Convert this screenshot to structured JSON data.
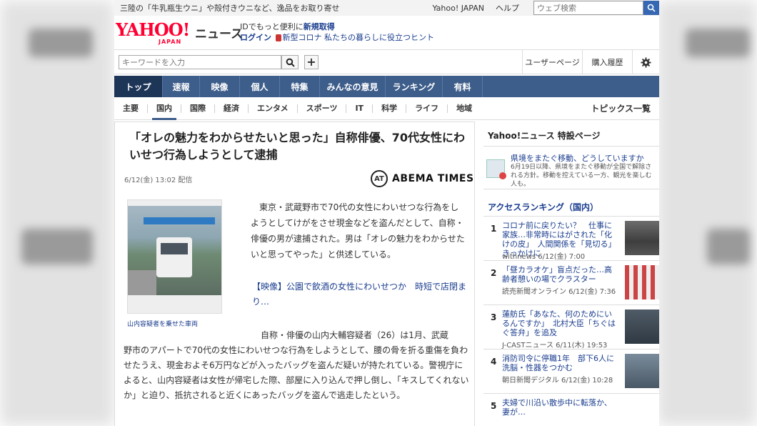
{
  "top_strip": {
    "promo": "三陸の「牛乳瓶生ウニ」や殻付きウニなど、逸品をお取り寄せ",
    "links": [
      "Yahoo! JAPAN",
      "ヘルプ"
    ],
    "web_search_placeholder": "ウェブ検索"
  },
  "header": {
    "logo": "YAHOO!",
    "logo_sub": "JAPAN",
    "news": "ニュース",
    "line1_text": "IDでもっと便利に",
    "line1_link": "新規取得",
    "login": "ログイン",
    "covid": "新型コロナ 私たちの暮らしに役立つヒント"
  },
  "search": {
    "placeholder": "キーワードを入力",
    "user_page": "ユーザーページ",
    "purchase": "購入履歴"
  },
  "main_nav": [
    "トップ",
    "速報",
    "映像",
    "個人",
    "特集",
    "みんなの意見",
    "ランキング",
    "有料"
  ],
  "sub_nav": [
    "主要",
    "国内",
    "国際",
    "経済",
    "エンタメ",
    "スポーツ",
    "IT",
    "科学",
    "ライフ",
    "地域"
  ],
  "sub_nav_right": "トピックス一覧",
  "article": {
    "headline": "「オレの魅力をわからせたいと思った」自称俳優、70代女性にわいせつ行為しようとして逮捕",
    "date": "6/12(金) 13:02 配信",
    "source": "ABEMA TIMES",
    "source_mark": "AT",
    "caption": "山内容疑者を乗せた車両",
    "p1": "東京・武蔵野市で70代の女性にわいせつな行為をしようとしてけがをさせ現金などを盗んだとして、自称・俳優の男が逮捕された。男は「オレの魅力をわからせたいと思ってやった」と供述している。",
    "related": "【映像】公園で飲酒の女性にわいせつか　時短で店閉まり…",
    "p2_first": "自称・俳優の山内大輔容疑者（26）は1月、武蔵",
    "p2_rest": "野市のアパートで70代の女性にわいせつな行為をしようとして、腰の骨を折る重傷を負わせたうえ、現金およそ6万円などが入ったバッグを盗んだ疑いが持たれている。警視庁によると、山内容疑者は女性が帰宅した際、部屋に入り込んで押し倒し、「キスしてくれないか」と迫り、抵抗されると近くにあったバッグを盗んで逃走したという。"
  },
  "sidebar": {
    "special_title": "Yahoo!ニュース 特設ページ",
    "special_item_title": "県境をまたぐ移動、どうしていますか",
    "special_item_desc": "6月19日以降、県境をまたぐ移動が全国で解除される方針。移動を控えている一方、観光を楽しむ人も。",
    "ranking_title": "アクセスランキング（国内）",
    "ranking": [
      {
        "num": "1",
        "title": "コロナ前に戻りたい？　仕事に家族…非常時にはがされた「化けの皮」　人間関係を「見切る」きっかけに",
        "src": "withnews 6/12(金) 7:00"
      },
      {
        "num": "2",
        "title": "「昼カラオケ」盲点だった…高齢者憩いの場でクラスター",
        "src": "読売新聞オンライン 6/12(金) 7:36"
      },
      {
        "num": "3",
        "title": "蓮舫氏「あなた、何のためにいるんですか」　北村大臣「ちぐはぐ答弁」を追及",
        "src": "J-CASTニュース 6/11(木) 19:53"
      },
      {
        "num": "4",
        "title": "消防司令に停職1年　部下6人に洗脳・性器をつかむ",
        "src": "朝日新聞デジタル 6/12(金) 10:28"
      },
      {
        "num": "5",
        "title": "夫婦で川沿い散歩中に転落か、妻が…",
        "src": ""
      }
    ]
  }
}
